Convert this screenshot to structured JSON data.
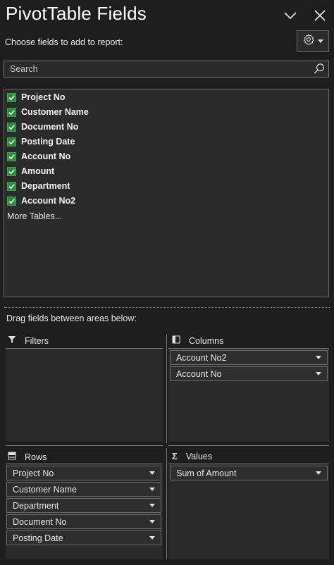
{
  "header": {
    "title": "PivotTable Fields",
    "subtitle": "Choose fields to add to report:"
  },
  "search": {
    "placeholder": "Search"
  },
  "fields": [
    {
      "label": "Project No",
      "checked": true
    },
    {
      "label": "Customer Name",
      "checked": true
    },
    {
      "label": "Document No",
      "checked": true
    },
    {
      "label": "Posting Date",
      "checked": true
    },
    {
      "label": "Account No",
      "checked": true
    },
    {
      "label": "Amount",
      "checked": true
    },
    {
      "label": "Department",
      "checked": true
    },
    {
      "label": "Account No2",
      "checked": true
    }
  ],
  "more_tables": "More Tables...",
  "drag_label": "Drag fields between areas below:",
  "areas": {
    "filters": {
      "label": "Filters",
      "items": []
    },
    "columns": {
      "label": "Columns",
      "items": [
        "Account No2",
        "Account No"
      ]
    },
    "rows": {
      "label": "Rows",
      "items": [
        "Project No",
        "Customer Name",
        "Department",
        "Document No",
        "Posting Date"
      ]
    },
    "values": {
      "label": "Values",
      "items": [
        "Sum of Amount"
      ]
    }
  },
  "colors": {
    "background": "#1e1e1e",
    "panel": "#2b2b2b",
    "checkbox": "#2e8b3e"
  }
}
